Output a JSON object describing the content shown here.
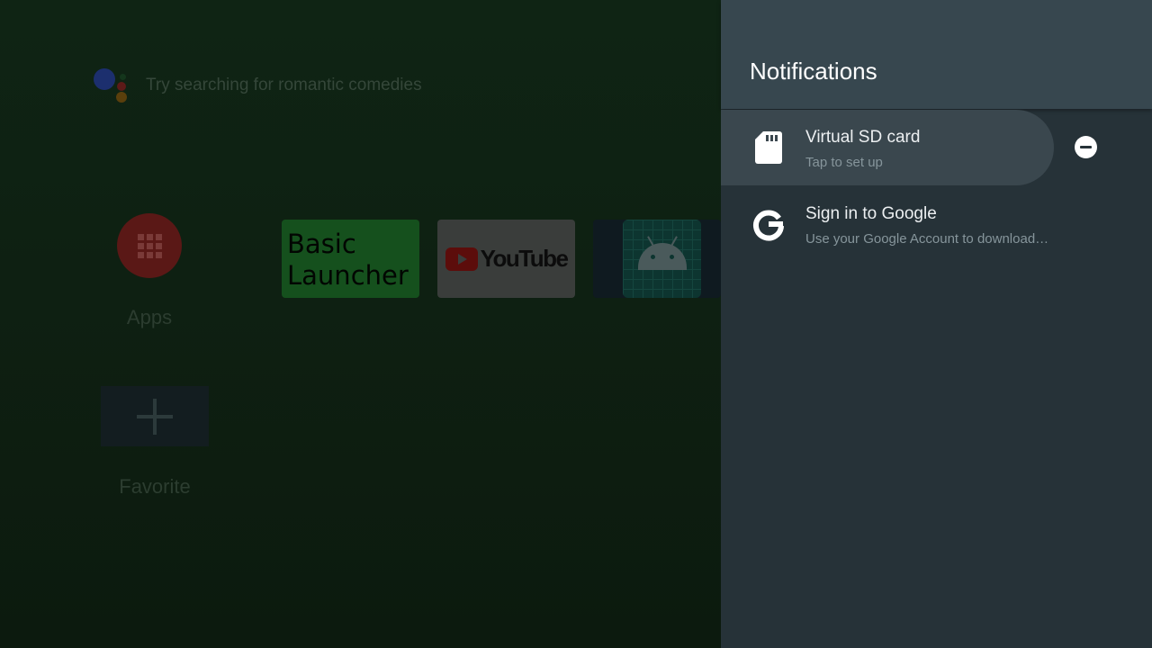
{
  "home": {
    "search_hint": "Try searching for romantic comedies",
    "apps_label": "Apps",
    "favorite_label": "Favorite",
    "tiles": {
      "basic_launcher": "Basic Launcher",
      "youtube": "YouTube"
    }
  },
  "notifications": {
    "title": "Notifications",
    "items": [
      {
        "title": "Virtual SD card",
        "subtitle": "Tap to set up",
        "icon": "sd-card-icon"
      },
      {
        "title": "Sign in to Google",
        "subtitle": "Use your Google Account to download…",
        "icon": "google-icon"
      }
    ],
    "dismiss_icon": "minus-circle-icon"
  },
  "colors": {
    "panel_bg": "#263238",
    "panel_header_bg": "#37474f",
    "focused_row_bg": "#3a474e"
  }
}
